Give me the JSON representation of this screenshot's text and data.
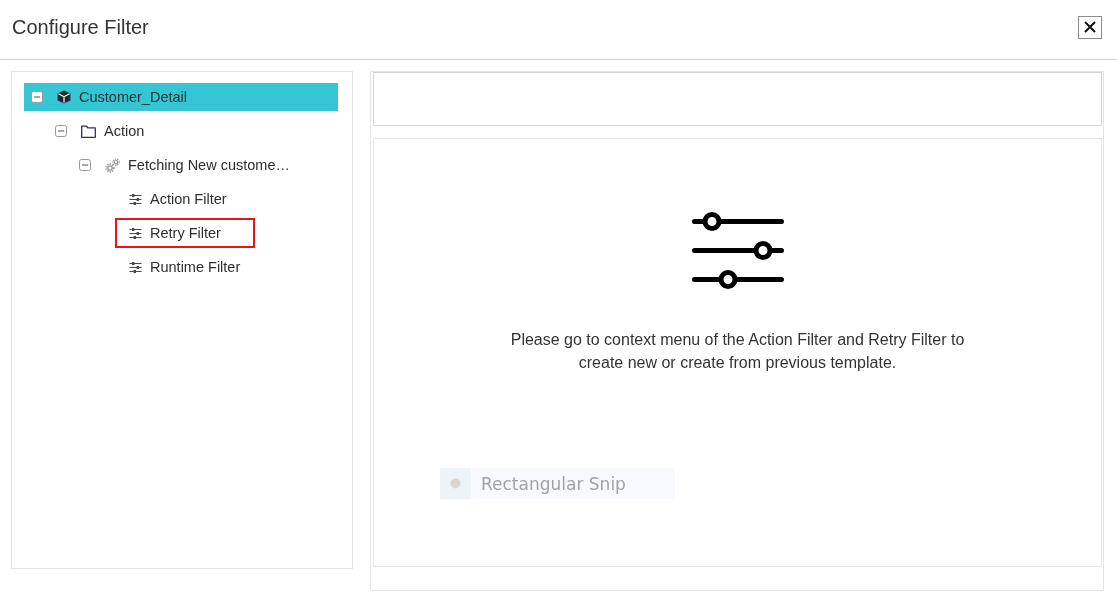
{
  "dialog": {
    "title": "Configure Filter"
  },
  "tree": [
    {
      "label": "Customer_Detail",
      "kind": "entity",
      "selected": true,
      "expanded": true,
      "outlined": false,
      "children": [
        {
          "label": "Action",
          "kind": "folder",
          "selected": false,
          "expanded": true,
          "outlined": false,
          "children": [
            {
              "label": "Fetching New custome…",
              "kind": "process",
              "selected": false,
              "expanded": true,
              "outlined": false,
              "children": [
                {
                  "label": "Action Filter",
                  "kind": "filter",
                  "selected": false,
                  "outlined": false
                },
                {
                  "label": "Retry Filter",
                  "kind": "filter",
                  "selected": false,
                  "outlined": true
                },
                {
                  "label": "Runtime Filter",
                  "kind": "filter",
                  "selected": false,
                  "outlined": false
                }
              ]
            }
          ]
        }
      ]
    }
  ],
  "empty_state": {
    "message": "Please go to context menu of the Action Filter and Retry Filter to create new or create from previous template."
  },
  "snip_overlay": {
    "label": "Rectangular Snip"
  }
}
